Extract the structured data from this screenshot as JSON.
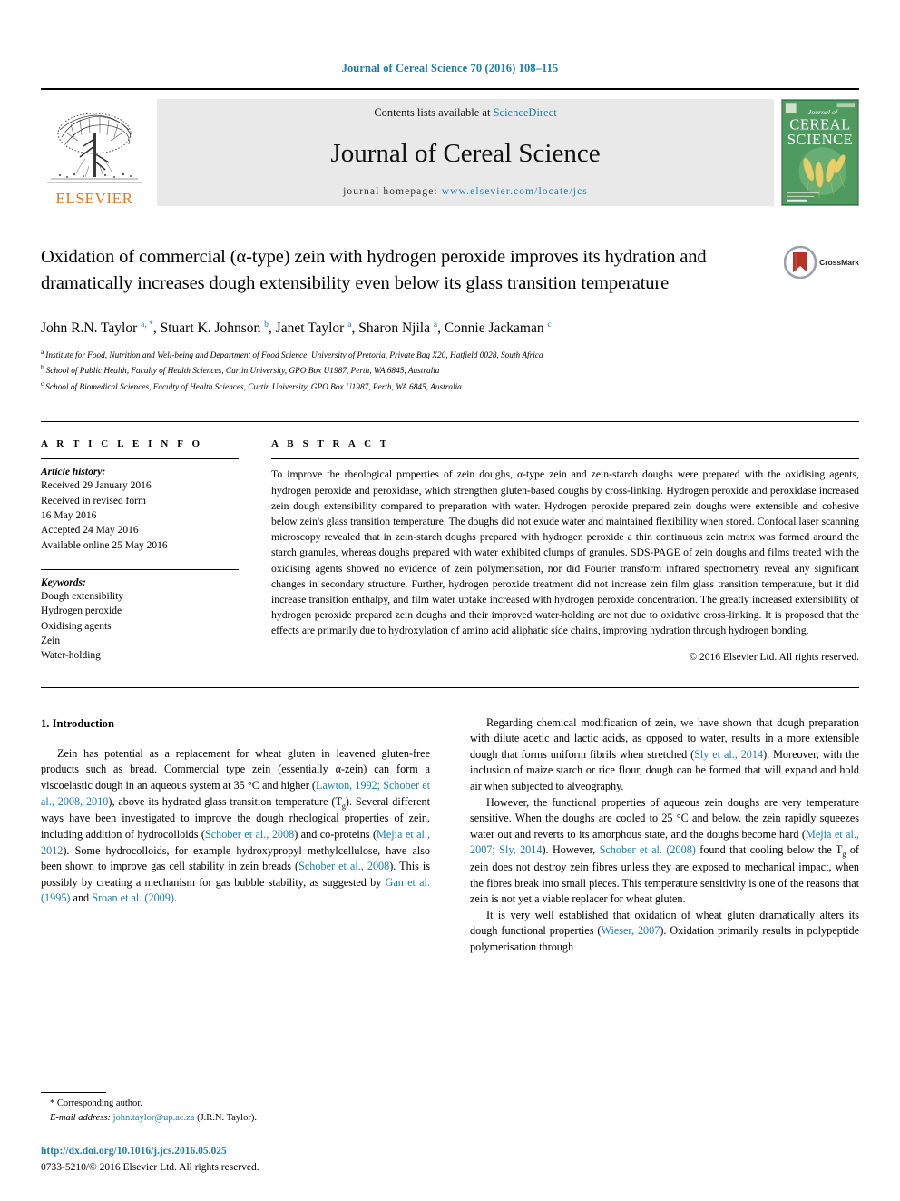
{
  "running_head": "Journal of Cereal Science 70 (2016) 108–115",
  "masthead": {
    "publisher": "ELSEVIER",
    "contents_prefix": "Contents lists available at ",
    "contents_link": "ScienceDirect",
    "journal_title": "Journal of Cereal Science",
    "homepage_prefix": "journal homepage: ",
    "homepage_url": "www.elsevier.com/locate/jcs",
    "cover": {
      "line1": "Journal of",
      "line2": "CEREAL",
      "line3": "SCIENCE"
    }
  },
  "article": {
    "title": "Oxidation of commercial (α-type) zein with hydrogen peroxide improves its hydration and dramatically increases dough extensibility even below its glass transition temperature",
    "crossmark_label": "CrossMark",
    "authors": [
      {
        "name": "John R.N. Taylor",
        "marks": "a, *"
      },
      {
        "name": "Stuart K. Johnson",
        "marks": "b"
      },
      {
        "name": "Janet Taylor",
        "marks": "a"
      },
      {
        "name": "Sharon Njila",
        "marks": "a"
      },
      {
        "name": "Connie Jackaman",
        "marks": "c"
      }
    ],
    "affiliations": [
      {
        "mark": "a",
        "text": "Institute for Food, Nutrition and Well-being and Department of Food Science, University of Pretoria, Private Bag X20, Hatfield 0028, South Africa"
      },
      {
        "mark": "b",
        "text": "School of Public Health, Faculty of Health Sciences, Curtin University, GPO Box U1987, Perth, WA 6845, Australia"
      },
      {
        "mark": "c",
        "text": "School of Biomedical Sciences, Faculty of Health Sciences, Curtin University, GPO Box U1987, Perth, WA 6845, Australia"
      }
    ]
  },
  "article_info": {
    "label": "A R T I C L E   I N F O",
    "history_title": "Article history:",
    "history": [
      "Received 29 January 2016",
      "Received in revised form",
      "16 May 2016",
      "Accepted 24 May 2016",
      "Available online 25 May 2016"
    ],
    "keywords_title": "Keywords:",
    "keywords": [
      "Dough extensibility",
      "Hydrogen peroxide",
      "Oxidising agents",
      "Zein",
      "Water-holding"
    ]
  },
  "abstract": {
    "label": "A B S T R A C T",
    "text": "To improve the rheological properties of zein doughs, α-type zein and zein-starch doughs were prepared with the oxidising agents, hydrogen peroxide and peroxidase, which strengthen gluten-based doughs by cross-linking. Hydrogen peroxide and peroxidase increased zein dough extensibility compared to preparation with water. Hydrogen peroxide prepared zein doughs were extensible and cohesive below zein's glass transition temperature. The doughs did not exude water and maintained flexibility when stored. Confocal laser scanning microscopy revealed that in zein-starch doughs prepared with hydrogen peroxide a thin continuous zein matrix was formed around the starch granules, whereas doughs prepared with water exhibited clumps of granules. SDS-PAGE of zein doughs and films treated with the oxidising agents showed no evidence of zein polymerisation, nor did Fourier transform infrared spectrometry reveal any significant changes in secondary structure. Further, hydrogen peroxide treatment did not increase zein film glass transition temperature, but it did increase transition enthalpy, and film water uptake increased with hydrogen peroxide concentration. The greatly increased extensibility of hydrogen peroxide prepared zein doughs and their improved water-holding are not due to oxidative cross-linking. It is proposed that the effects are primarily due to hydroxylation of amino acid aliphatic side chains, improving hydration through hydrogen bonding.",
    "copyright": "© 2016 Elsevier Ltd. All rights reserved."
  },
  "introduction": {
    "heading": "1. Introduction",
    "left_paragraphs": [
      {
        "segments": [
          {
            "t": "Zein has potential as a replacement for wheat gluten in leavened gluten-free products such as bread. Commercial type zein (essentially α-zein) can form a viscoelastic dough in an aqueous system at 35 °C and higher (",
            "k": "p"
          },
          {
            "t": "Lawton, 1992; Schober et al., 2008, 2010",
            "k": "r"
          },
          {
            "t": "), above its hydrated glass transition temperature (T",
            "k": "p"
          },
          {
            "t": "g",
            "k": "sub"
          },
          {
            "t": "). Several different ways have been investigated to improve the dough rheological properties of zein, including addition of hydrocolloids (",
            "k": "p"
          },
          {
            "t": "Schober et al., 2008",
            "k": "r"
          },
          {
            "t": ") and co-proteins (",
            "k": "p"
          },
          {
            "t": "Mejia et al., 2012",
            "k": "r"
          },
          {
            "t": "). Some hydrocolloids, for example hydroxypropyl methylcellulose, have also been shown to improve gas cell stability in zein breads (",
            "k": "p"
          },
          {
            "t": "Schober et al., 2008",
            "k": "r"
          },
          {
            "t": "). This is possibly by creating a mechanism for gas bubble stability, as suggested by ",
            "k": "p"
          },
          {
            "t": "Gan et al. (1995)",
            "k": "r"
          },
          {
            "t": " and ",
            "k": "p"
          },
          {
            "t": "Sroan et al. (2009)",
            "k": "r"
          },
          {
            "t": ".",
            "k": "p"
          }
        ]
      }
    ],
    "right_paragraphs": [
      {
        "segments": [
          {
            "t": "Regarding chemical modification of zein, we have shown that dough preparation with dilute acetic and lactic acids, as opposed to water, results in a more extensible dough that forms uniform fibrils when stretched (",
            "k": "p"
          },
          {
            "t": "Sly et al., 2014",
            "k": "r"
          },
          {
            "t": "). Moreover, with the inclusion of maize starch or rice flour, dough can be formed that will expand and hold air when subjected to alveography.",
            "k": "p"
          }
        ]
      },
      {
        "segments": [
          {
            "t": "However, the functional properties of aqueous zein doughs are very temperature sensitive. When the doughs are cooled to 25 °C and below, the zein rapidly squeezes water out and reverts to its amorphous state, and the doughs become hard (",
            "k": "p"
          },
          {
            "t": "Mejia et al., 2007; Sly, 2014",
            "k": "r"
          },
          {
            "t": "). However, ",
            "k": "p"
          },
          {
            "t": "Schober et al. (2008)",
            "k": "r"
          },
          {
            "t": " found that cooling below the T",
            "k": "p"
          },
          {
            "t": "g",
            "k": "sub"
          },
          {
            "t": " of zein does not destroy zein fibres unless they are exposed to mechanical impact, when the fibres break into small pieces. This temperature sensitivity is one of the reasons that zein is not yet a viable replacer for wheat gluten.",
            "k": "p"
          }
        ]
      },
      {
        "segments": [
          {
            "t": "It is very well established that oxidation of wheat gluten dramatically alters its dough functional properties (",
            "k": "p"
          },
          {
            "t": "Wieser, 2007",
            "k": "r"
          },
          {
            "t": "). Oxidation primarily results in polypeptide polymerisation through",
            "k": "p"
          }
        ]
      }
    ]
  },
  "footer": {
    "corresponding_author": "* Corresponding author.",
    "email_label": "E-mail address:",
    "email": "john.taylor@up.ac.za",
    "email_suffix": "(J.R.N. Taylor).",
    "doi": "http://dx.doi.org/10.1016/j.jcs.2016.05.025",
    "issn_line": "0733-5210/© 2016 Elsevier Ltd. All rights reserved."
  },
  "colors": {
    "link": "#1b7fa8",
    "elsevier_orange": "#e87722",
    "masthead_grey": "#e9e9e9"
  }
}
